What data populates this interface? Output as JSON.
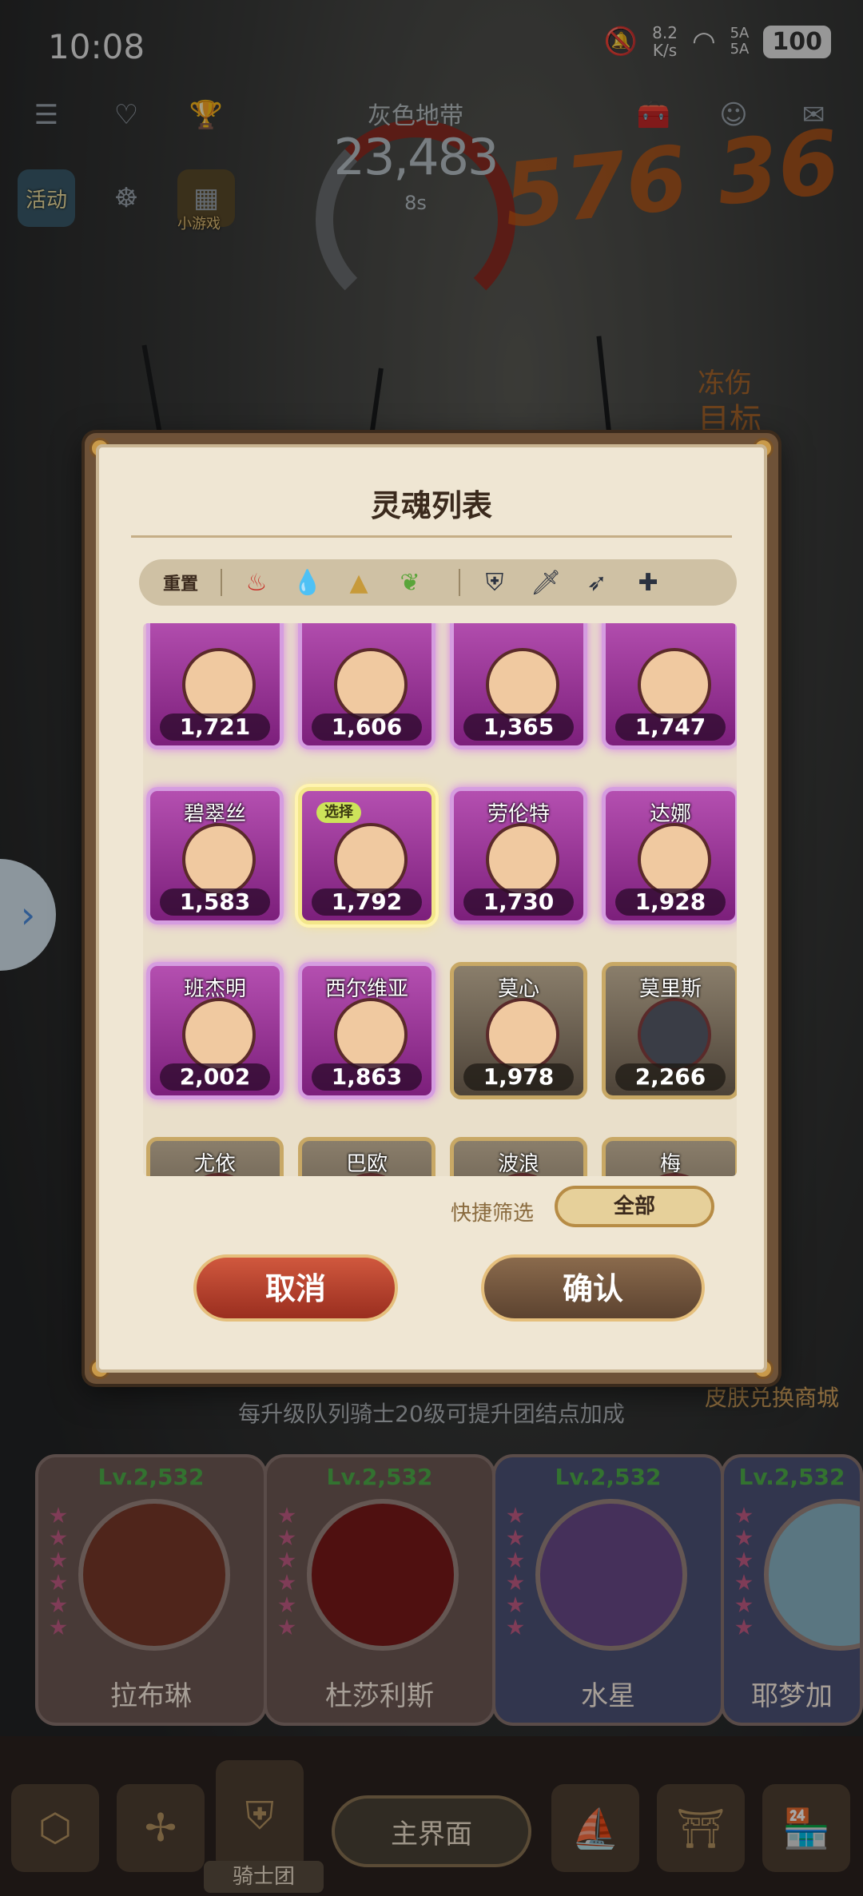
{
  "status_bar": {
    "time": "10:08",
    "net_speed_value": "8.2",
    "net_speed_unit": "K/s",
    "signal1": "5A",
    "signal2": "5A",
    "battery": "100"
  },
  "hud": {
    "zone_name": "灰色地带",
    "zone_count": "23,483",
    "zone_time": "8s",
    "damage_numbers": "576 36",
    "frost_label": "冻伤",
    "target_label": "目标",
    "left_icons": [
      {
        "label": "活动",
        "icon": "activity-icon"
      },
      {
        "label": "",
        "icon": "wheel-icon"
      },
      {
        "label": "小游戏",
        "icon": "minigame-icon"
      }
    ]
  },
  "dialog": {
    "title": "灵魂列表",
    "reset_label": "重置",
    "element_filters": [
      "fire-element-icon",
      "water-element-icon",
      "earth-element-icon",
      "wind-element-icon"
    ],
    "class_filters": [
      "tank-class-icon",
      "sword-class-icon",
      "ranged-class-icon",
      "healer-class-icon"
    ],
    "quick_filter_label": "快捷筛选",
    "quick_filter_value": "全部",
    "cancel_label": "取消",
    "confirm_label": "确认",
    "selected_badge": "选择",
    "souls": [
      {
        "name": "",
        "power": "1,721",
        "rarity": "purple",
        "face": "skin"
      },
      {
        "name": "",
        "power": "1,606",
        "rarity": "purple",
        "face": "skin"
      },
      {
        "name": "",
        "power": "1,365",
        "rarity": "purple",
        "face": "skin"
      },
      {
        "name": "",
        "power": "1,747",
        "rarity": "purple",
        "face": "skin"
      },
      {
        "name": "碧翠丝",
        "power": "1,583",
        "rarity": "purple",
        "face": "skin"
      },
      {
        "name": "",
        "power": "1,792",
        "rarity": "purple",
        "face": "skin",
        "selected": true
      },
      {
        "name": "劳伦特",
        "power": "1,730",
        "rarity": "purple",
        "face": "skin"
      },
      {
        "name": "达娜",
        "power": "1,928",
        "rarity": "purple",
        "face": "skin"
      },
      {
        "name": "班杰明",
        "power": "2,002",
        "rarity": "purple",
        "face": "skin"
      },
      {
        "name": "西尔维亚",
        "power": "1,863",
        "rarity": "purple",
        "face": "skin"
      },
      {
        "name": "莫心",
        "power": "1,978",
        "rarity": "gold",
        "face": "skin"
      },
      {
        "name": "莫里斯",
        "power": "2,266",
        "rarity": "gold",
        "face": "dark"
      },
      {
        "name": "尤依",
        "power": "",
        "rarity": "gold",
        "face": "grey"
      },
      {
        "name": "巴欧",
        "power": "",
        "rarity": "gold",
        "face": "grey"
      },
      {
        "name": "波浪",
        "power": "",
        "rarity": "gold",
        "face": "blue"
      },
      {
        "name": "梅",
        "power": "",
        "rarity": "gold",
        "face": "skin"
      }
    ]
  },
  "bottom": {
    "tip": "每升级队列骑士20级可提升团结点加成",
    "skin_shop": "皮肤兑换商城",
    "knights": [
      {
        "level": "Lv.2,532",
        "name": "拉布琳"
      },
      {
        "level": "Lv.2,532",
        "name": "杜莎利斯"
      },
      {
        "level": "Lv.2,532",
        "name": "水星"
      },
      {
        "level": "Lv.2,532",
        "name": "耶梦加"
      }
    ],
    "knights_label": "骑士团",
    "main_screen_label": "主界面"
  }
}
